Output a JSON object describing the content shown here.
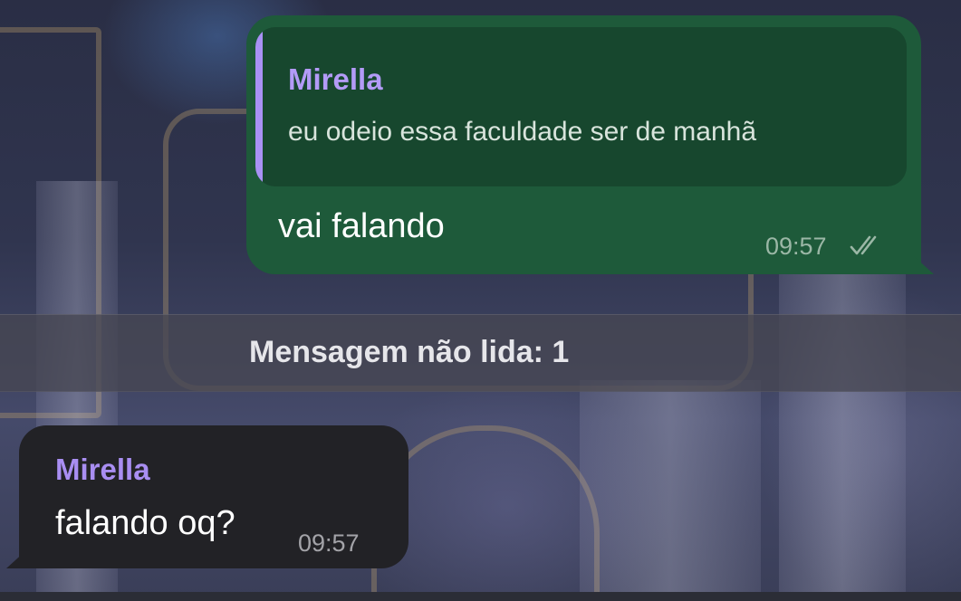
{
  "chat": {
    "outgoing_message": {
      "reply_to": {
        "author": "Mirella",
        "text": "eu odeio essa faculdade ser de manhã"
      },
      "text": "vai falando",
      "time": "09:57",
      "status_icon": "double-check-icon"
    },
    "unread_divider": {
      "label": "Mensagem não lida: 1"
    },
    "incoming_message": {
      "author": "Mirella",
      "text": "falando oq?",
      "time": "09:57"
    }
  },
  "colors": {
    "outgoing_bubble": "#1e5a3a",
    "reply_quote_bg": "#17472e",
    "reply_accent": "#a991f5",
    "incoming_bubble": "#222226",
    "author_name": "#b39bf7",
    "divider_bg": "#46464f"
  }
}
